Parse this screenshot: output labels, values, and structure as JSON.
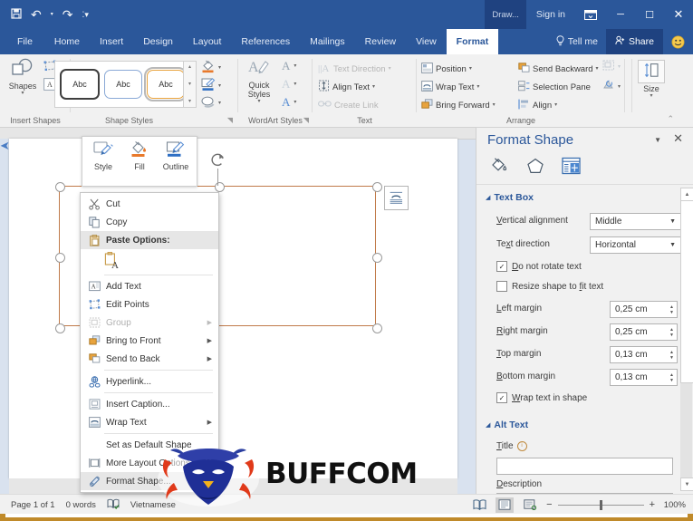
{
  "titlebar": {
    "qat": [
      {
        "name": "save-icon",
        "glyph": "💾"
      },
      {
        "name": "undo-icon",
        "glyph": "↶"
      },
      {
        "name": "redo-icon",
        "glyph": "↻"
      },
      {
        "name": "customize-qat-icon",
        "glyph": "⯆"
      }
    ],
    "draw_label": "Draw...",
    "signin_label": "Sign in",
    "ribbon_display_icon": "⬜",
    "minimize": "─",
    "maximize": "☐",
    "close": "✕"
  },
  "tabs": [
    {
      "label": "File",
      "active": false
    },
    {
      "label": "Home",
      "active": false
    },
    {
      "label": "Insert",
      "active": false
    },
    {
      "label": "Design",
      "active": false
    },
    {
      "label": "Layout",
      "active": false
    },
    {
      "label": "References",
      "active": false
    },
    {
      "label": "Mailings",
      "active": false
    },
    {
      "label": "Review",
      "active": false
    },
    {
      "label": "View",
      "active": false
    },
    {
      "label": "Format",
      "active": true
    }
  ],
  "tab_right": {
    "tellme_label": "Tell me",
    "share_label": "Share",
    "smiley": "🙂"
  },
  "ribbon": {
    "groups": [
      {
        "label": "Insert Shapes"
      },
      {
        "label": "Shape Styles"
      },
      {
        "label": "WordArt Styles"
      },
      {
        "label": "Text"
      },
      {
        "label": "Arrange"
      },
      {
        "label": "Size"
      }
    ],
    "insert_shapes": {
      "shapes_label": "Shapes",
      "edit_shape_name": "edit-shape-icon",
      "draw_textbox_name": "draw-textbox-icon"
    },
    "shape_styles": {
      "swatches": [
        "Abc",
        "Abc",
        "Abc"
      ],
      "selected_index": 2,
      "fill_label_name": "shape-fill-icon",
      "outline_label_name": "shape-outline-icon",
      "effects_label_name": "shape-effects-icon"
    },
    "wordart_styles": {
      "quick_styles_label": "Quick Styles",
      "text_fill_name": "text-fill-icon",
      "text_outline_name": "text-outline-icon",
      "text_effects_name": "text-effects-icon"
    },
    "text_group": {
      "items": [
        {
          "label": "Text Direction",
          "disabled": true,
          "caret": true
        },
        {
          "label": "Align Text",
          "disabled": false,
          "caret": true
        },
        {
          "label": "Create Link",
          "disabled": true,
          "caret": false
        }
      ]
    },
    "arrange_group": {
      "col1": [
        {
          "label": "Position",
          "caret": true
        },
        {
          "label": "Wrap Text",
          "caret": true
        },
        {
          "label": "Bring Forward",
          "caret": true
        }
      ],
      "col2": [
        {
          "label": "Send Backward",
          "caret": true
        },
        {
          "label": "Selection Pane",
          "caret": false
        },
        {
          "label": "Align",
          "caret": true
        }
      ]
    },
    "size_group": {
      "label": "Size"
    }
  },
  "mini_toolbar": [
    {
      "label": "Style",
      "icon": "shape-style-icon"
    },
    {
      "label": "Fill",
      "icon": "fill-bucket-icon"
    },
    {
      "label": "Outline",
      "icon": "outline-pen-icon"
    }
  ],
  "context_menu": [
    {
      "label": "Cut",
      "icon": "scissors-icon",
      "type": "item"
    },
    {
      "label": "Copy",
      "icon": "copy-icon",
      "type": "item"
    },
    {
      "label": "Paste Options:",
      "icon": "clipboard-icon",
      "type": "header"
    },
    {
      "label": "",
      "icon": "paste-keep-text-icon",
      "type": "paste-row"
    },
    {
      "type": "separator"
    },
    {
      "label": "Add Text",
      "icon": "add-text-icon",
      "type": "item"
    },
    {
      "label": "Edit Points",
      "icon": "edit-points-icon",
      "type": "item"
    },
    {
      "label": "Group",
      "icon": "group-icon",
      "type": "item",
      "disabled": true,
      "submenu": true
    },
    {
      "label": "Bring to Front",
      "icon": "bring-to-front-icon",
      "type": "item",
      "submenu": true
    },
    {
      "label": "Send to Back",
      "icon": "send-to-back-icon",
      "type": "item",
      "submenu": true
    },
    {
      "type": "separator"
    },
    {
      "label": "Hyperlink...",
      "icon": "hyperlink-icon",
      "type": "item"
    },
    {
      "type": "separator"
    },
    {
      "label": "Insert Caption...",
      "icon": "insert-caption-icon",
      "type": "item"
    },
    {
      "label": "Wrap Text",
      "icon": "wrap-text-icon",
      "type": "item",
      "submenu": true
    },
    {
      "type": "separator"
    },
    {
      "label": "Set as Default Shape",
      "icon": "",
      "type": "item",
      "noicon": true
    },
    {
      "label": "More Layout Options...",
      "icon": "layout-options-icon",
      "type": "item"
    },
    {
      "label": "Format Shape...",
      "icon": "format-shape-icon",
      "type": "item",
      "highlighted": true
    }
  ],
  "format_pane": {
    "title": "Format Shape",
    "dropdown_glyph": "▼",
    "close_glyph": "✕",
    "tabs": [
      {
        "name": "fill-line-tab",
        "active": false
      },
      {
        "name": "effects-tab",
        "active": false
      },
      {
        "name": "layout-properties-tab",
        "active": true
      }
    ],
    "textbox": {
      "section_label": "Text Box",
      "vertical_alignment": {
        "label": "Vertical alignment",
        "value": "Middle"
      },
      "text_direction": {
        "label": "Text direction",
        "value": "Horizontal"
      },
      "do_not_rotate": {
        "label": "Do not rotate text",
        "checked": true
      },
      "resize_shape": {
        "label": "Resize shape to fit text",
        "checked": false
      },
      "left_margin": {
        "label": "Left margin",
        "value": "0,25 cm"
      },
      "right_margin": {
        "label": "Right margin",
        "value": "0,25 cm"
      },
      "top_margin": {
        "label": "Top margin",
        "value": "0,13 cm"
      },
      "bottom_margin": {
        "label": "Bottom margin",
        "value": "0,13 cm"
      },
      "wrap_text": {
        "label": "Wrap text in shape",
        "checked": true
      }
    },
    "alt_text": {
      "section_label": "Alt Text",
      "title_label": "Title",
      "title_value": "",
      "description_label": "Description",
      "description_value": ""
    }
  },
  "status_bar": {
    "page": "Page 1 of 1",
    "words": "0 words",
    "proofing_icon": "proofing-icon",
    "language": "Vietnamese",
    "views": [
      {
        "name": "read-mode-icon",
        "active": false
      },
      {
        "name": "print-layout-icon",
        "active": true
      },
      {
        "name": "web-layout-icon",
        "active": false
      }
    ],
    "zoom_minus": "−",
    "zoom_plus": "+",
    "zoom_level": "100%"
  },
  "watermark": {
    "text": "BUFFCOM"
  }
}
